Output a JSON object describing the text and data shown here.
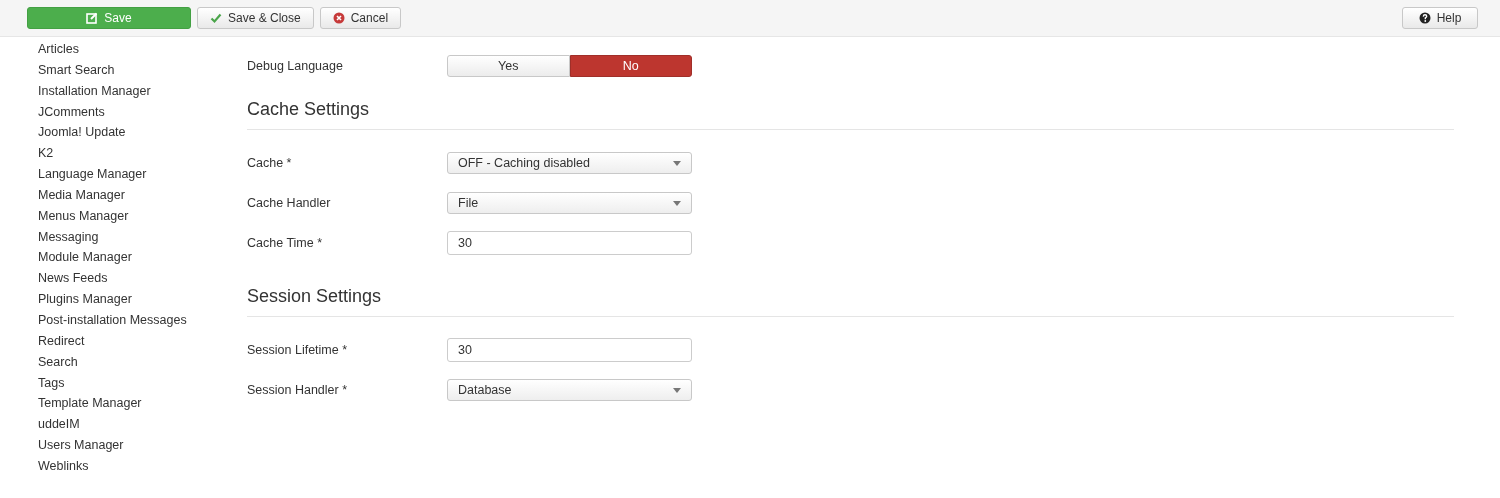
{
  "toolbar": {
    "buttons": [
      {
        "label": "Save",
        "kind": "primary"
      },
      {
        "label": "Save & Close",
        "kind": "check"
      },
      {
        "label": "Cancel",
        "kind": "cancel"
      }
    ],
    "help": "Help"
  },
  "sidebar": {
    "items": [
      "Articles",
      "Smart Search",
      "Installation Manager",
      "JComments",
      "Joomla! Update",
      "K2",
      "Language Manager",
      "Media Manager",
      "Menus Manager",
      "Messaging",
      "Module Manager",
      "News Feeds",
      "Plugins Manager",
      "Post-installation Messages",
      "Redirect",
      "Search",
      "Tags",
      "Template Manager",
      "uddeIM",
      "Users Manager",
      "Weblinks"
    ]
  },
  "sections": [
    {
      "fields": [
        {
          "label": "Debug Language",
          "kind": "toggle",
          "options": [
            {
              "label": "Yes",
              "selected": false
            },
            {
              "label": "No",
              "selected": true
            }
          ]
        }
      ]
    },
    {
      "title": "Cache Settings",
      "fields": [
        {
          "label": "Cache *",
          "kind": "select",
          "value": "OFF - Caching disabled"
        },
        {
          "label": "Cache Handler",
          "kind": "select",
          "value": "File"
        },
        {
          "label": "Cache Time *",
          "kind": "text",
          "value": "30"
        }
      ]
    },
    {
      "title": "Session Settings",
      "fields": [
        {
          "label": "Session Lifetime *",
          "kind": "text",
          "value": "30"
        },
        {
          "label": "Session Handler *",
          "kind": "select",
          "value": "Database"
        }
      ]
    }
  ]
}
